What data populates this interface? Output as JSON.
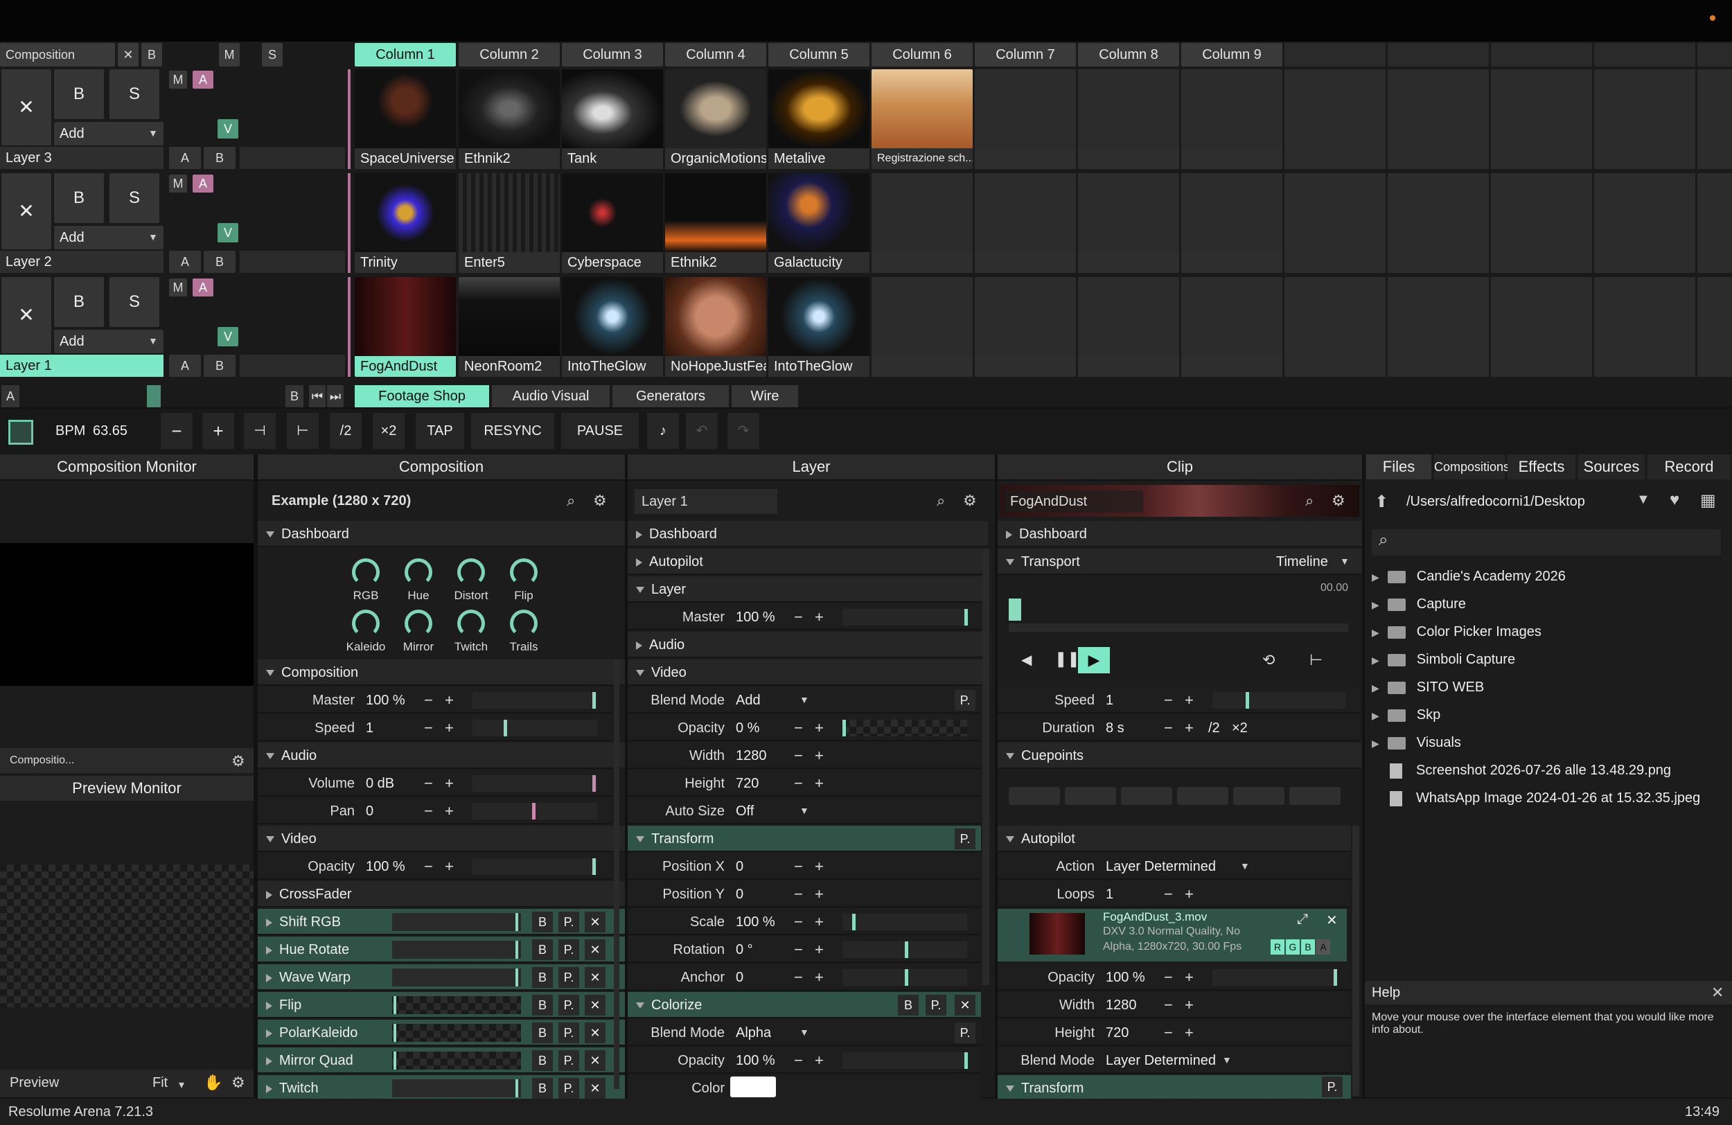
{
  "app": {
    "status_left": "Resolume Arena 7.21.3",
    "status_right": "13:49",
    "accent": "#7de8c6"
  },
  "comp_header": {
    "label": "Composition",
    "x": "✕",
    "b": "B",
    "m": "M",
    "s": "S"
  },
  "columns": [
    "Column 1",
    "Column 2",
    "Column 3",
    "Column 4",
    "Column 5",
    "Column 6",
    "Column 7",
    "Column 8",
    "Column 9"
  ],
  "layers": [
    {
      "name": "Layer 3",
      "b": "B",
      "s": "S",
      "m": "M",
      "a": "A",
      "v": "V",
      "add": "Add",
      "ab_a": "A",
      "ab_b": "B",
      "clips": [
        "SpaceUniverse",
        "Ethnik2",
        "Tank",
        "OrganicMotions",
        "Metalive",
        "Registrazione sch..."
      ]
    },
    {
      "name": "Layer 2",
      "b": "B",
      "s": "S",
      "m": "M",
      "a": "A",
      "v": "V",
      "add": "Add",
      "ab_a": "A",
      "ab_b": "B",
      "clips": [
        "Trinity",
        "Enter5",
        "Cyberspace",
        "Ethnik2",
        "Galactucity"
      ]
    },
    {
      "name": "Layer 1",
      "b": "B",
      "s": "S",
      "m": "M",
      "a": "A",
      "v": "V",
      "add": "Add",
      "ab_a": "A",
      "ab_b": "B",
      "clips": [
        "FogAndDust",
        "NeonRoom2",
        "IntoTheGlow",
        "NoHopeJustFear",
        "IntoTheGlow"
      ]
    }
  ],
  "deck": {
    "a": "A",
    "b": "B",
    "tabs": [
      "Footage Shop",
      "Audio Visual",
      "Generators",
      "Wire"
    ]
  },
  "toolbar": {
    "bpm_label": "BPM",
    "bpm": "63.65",
    "minus": "−",
    "plus": "+",
    "half": "/2",
    "double": "×2",
    "tap": "TAP",
    "resync": "RESYNC",
    "pause": "PAUSE"
  },
  "monitors": {
    "comp_title": "Composition Monitor",
    "comp_select": "Compositio...",
    "preview_title": "Preview Monitor",
    "preview_label": "Preview",
    "fit": "Fit"
  },
  "composition": {
    "title": "Composition",
    "name": "Example (1280 x 720)",
    "dashboard": "Dashboard",
    "knobs": [
      "RGB",
      "Hue",
      "Distort",
      "Flip",
      "Kaleido",
      "Mirror",
      "Twitch",
      "Trails"
    ],
    "sec_comp": "Composition",
    "master_l": "Master",
    "master_v": "100 %",
    "speed_l": "Speed",
    "speed_v": "1",
    "sec_audio": "Audio",
    "volume_l": "Volume",
    "volume_v": "0 dB",
    "pan_l": "Pan",
    "pan_v": "0",
    "sec_video": "Video",
    "opacity_l": "Opacity",
    "opacity_v": "100 %",
    "crossfader": "CrossFader",
    "effects": [
      "Shift RGB",
      "Hue Rotate",
      "Wave Warp",
      "Flip",
      "PolarKaleido",
      "Mirror Quad",
      "Twitch"
    ],
    "fx_b": "B",
    "fx_p": "P.",
    "fx_x": "✕"
  },
  "layer_panel": {
    "title": "Layer",
    "name": "Layer 1",
    "dashboard": "Dashboard",
    "autopilot": "Autopilot",
    "layer": "Layer",
    "master_l": "Master",
    "master_v": "100 %",
    "audio": "Audio",
    "video": "Video",
    "blend_l": "Blend Mode",
    "blend_v": "Add",
    "opacity_l": "Opacity",
    "opacity_v": "0 %",
    "width_l": "Width",
    "width_v": "1280",
    "height_l": "Height",
    "height_v": "720",
    "autosize_l": "Auto Size",
    "autosize_v": "Off",
    "transform": "Transform",
    "posx_l": "Position X",
    "posx_v": "0",
    "posy_l": "Position Y",
    "posy_v": "0",
    "scale_l": "Scale",
    "scale_v": "100 %",
    "rot_l": "Rotation",
    "rot_v": "0 °",
    "anchor_l": "Anchor",
    "anchor_v": "0",
    "colorize": "Colorize",
    "c_blend_l": "Blend Mode",
    "c_blend_v": "Alpha",
    "c_opacity_l": "Opacity",
    "c_opacity_v": "100 %",
    "color_l": "Color",
    "p": "P."
  },
  "clip_panel": {
    "title": "Clip",
    "name": "FogAndDust",
    "dashboard": "Dashboard",
    "transport": "Transport",
    "timeline": "Timeline",
    "time": "00.00",
    "speed_l": "Speed",
    "speed_v": "1",
    "duration_l": "Duration",
    "duration_v": "8 s",
    "half": "/2",
    "double": "×2",
    "cuepoints": "Cuepoints",
    "autopilot": "Autopilot",
    "action_l": "Action",
    "action_v": "Layer Determined",
    "loops_l": "Loops",
    "loops_v": "1",
    "file_name": "FogAndDust_3.mov",
    "file_info1": "DXV 3.0 Normal Quality, No",
    "file_info2": "Alpha, 1280x720, 30.00 Fps",
    "r": "R",
    "g": "G",
    "b": "B",
    "a": "A",
    "opacity_l": "Opacity",
    "opacity_v": "100 %",
    "width_l": "Width",
    "width_v": "1280",
    "height_l": "Height",
    "height_v": "720",
    "blend_l": "Blend Mode",
    "blend_v": "Layer Determined",
    "transform": "Transform",
    "p": "P."
  },
  "browser": {
    "tabs": [
      "Files",
      "Compositions",
      "Effects",
      "Sources",
      "Record"
    ],
    "path": "/Users/alfredocorni1/Desktop",
    "folders": [
      "Candie's Academy 2026",
      "Capture",
      "Color Picker Images",
      "Simboli Capture",
      "SITO WEB",
      "Skp",
      "Visuals"
    ],
    "files": [
      "Screenshot 2026-07-26 alle 13.48.29.png",
      "WhatsApp Image 2024-01-26 at 15.32.35.jpeg"
    ]
  },
  "help": {
    "title": "Help",
    "text": "Move your mouse over the interface element that you would like more info about."
  }
}
